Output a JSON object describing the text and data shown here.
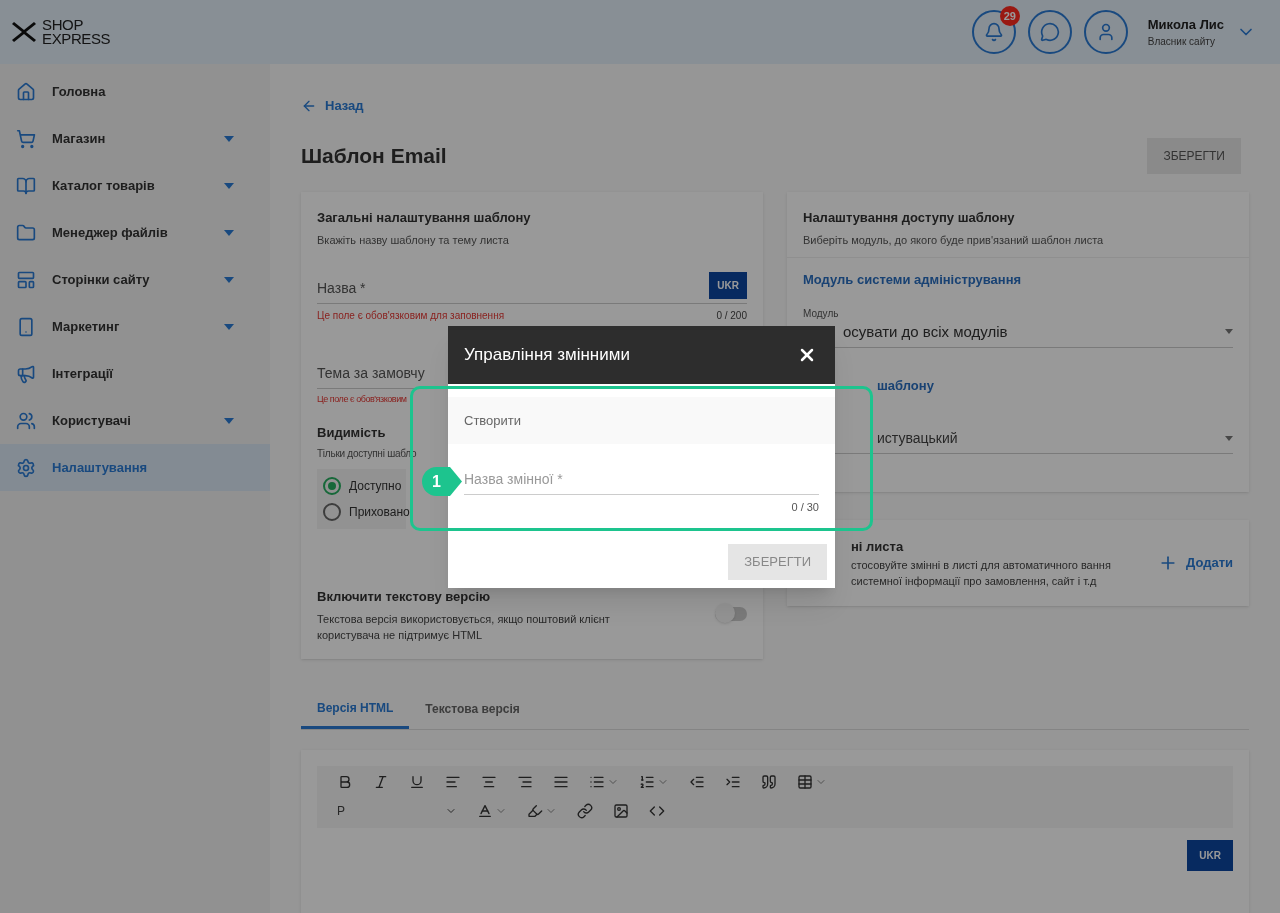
{
  "header": {
    "logo_line1": "SHOP",
    "logo_line2": "EXPRESS",
    "notification_count": "29",
    "user_name": "Микола Лис",
    "user_role": "Власник сайту"
  },
  "sidebar": {
    "items": [
      {
        "label": "Головна",
        "has_submenu": false,
        "selected": false
      },
      {
        "label": "Магазин",
        "has_submenu": true,
        "selected": false
      },
      {
        "label": "Каталог товарів",
        "has_submenu": true,
        "selected": false
      },
      {
        "label": "Менеджер файлів",
        "has_submenu": true,
        "selected": false
      },
      {
        "label": "Сторінки сайту",
        "has_submenu": true,
        "selected": false
      },
      {
        "label": "Маркетинг",
        "has_submenu": true,
        "selected": false
      },
      {
        "label": "Інтеграції",
        "has_submenu": false,
        "selected": false
      },
      {
        "label": "Користувачі",
        "has_submenu": true,
        "selected": false
      },
      {
        "label": "Налаштування",
        "has_submenu": false,
        "selected": true
      }
    ]
  },
  "page": {
    "back": "Назад",
    "title": "Шаблон Email",
    "save": "ЗБЕРЕГТИ"
  },
  "general_card": {
    "title": "Загальні налаштування шаблону",
    "subtitle": "Вкажіть назву шаблону та тему листа",
    "name_field": {
      "placeholder": "Назва *",
      "lang": "UKR",
      "error": "Це поле є обов'язковим для заповнення",
      "counter": "0 / 200"
    },
    "subject_field": {
      "placeholder": "Тема за замовчу",
      "error": "Це поле є обов'язковим"
    },
    "visibility": {
      "title": "Видимість",
      "subtitle": "Тільки доступні шабло",
      "options": [
        {
          "label": "Доступно",
          "selected": true
        },
        {
          "label": "Приховано",
          "selected": false
        }
      ]
    },
    "text_version": {
      "title": "Включити текстову версію",
      "description": "Текстова версія використовується, якщо поштовий клієнт користувача не підтримує HTML",
      "on": false
    }
  },
  "access_card": {
    "title": "Налаштування доступу шаблону",
    "subtitle": "Виберіть модуль, до якого буде прив'язаний шаблон листа",
    "module_heading": "Модуль системи адміністрування",
    "module_select": {
      "label": "Модуль",
      "value": "осувати до всіх модулів"
    },
    "type_heading": "шаблону",
    "type_select": {
      "value": "истувацький"
    }
  },
  "variables_card": {
    "title": "ні листа",
    "description": "стосовуйте змінні в листі для автоматичного вання системної інформації про замовлення, сайт і т.д",
    "add": "Додати"
  },
  "editor": {
    "tabs": [
      {
        "label": "Версія HTML",
        "selected": true
      },
      {
        "label": "Текстова версія",
        "selected": false
      }
    ],
    "format": "P",
    "lang": "UKR"
  },
  "modal": {
    "title": "Управління змінними",
    "section": "Створити",
    "field": {
      "placeholder": "Назва змінної *",
      "counter": "0 / 30"
    },
    "save": "ЗБЕРЕГТИ"
  },
  "annotation": {
    "marker": "1"
  }
}
